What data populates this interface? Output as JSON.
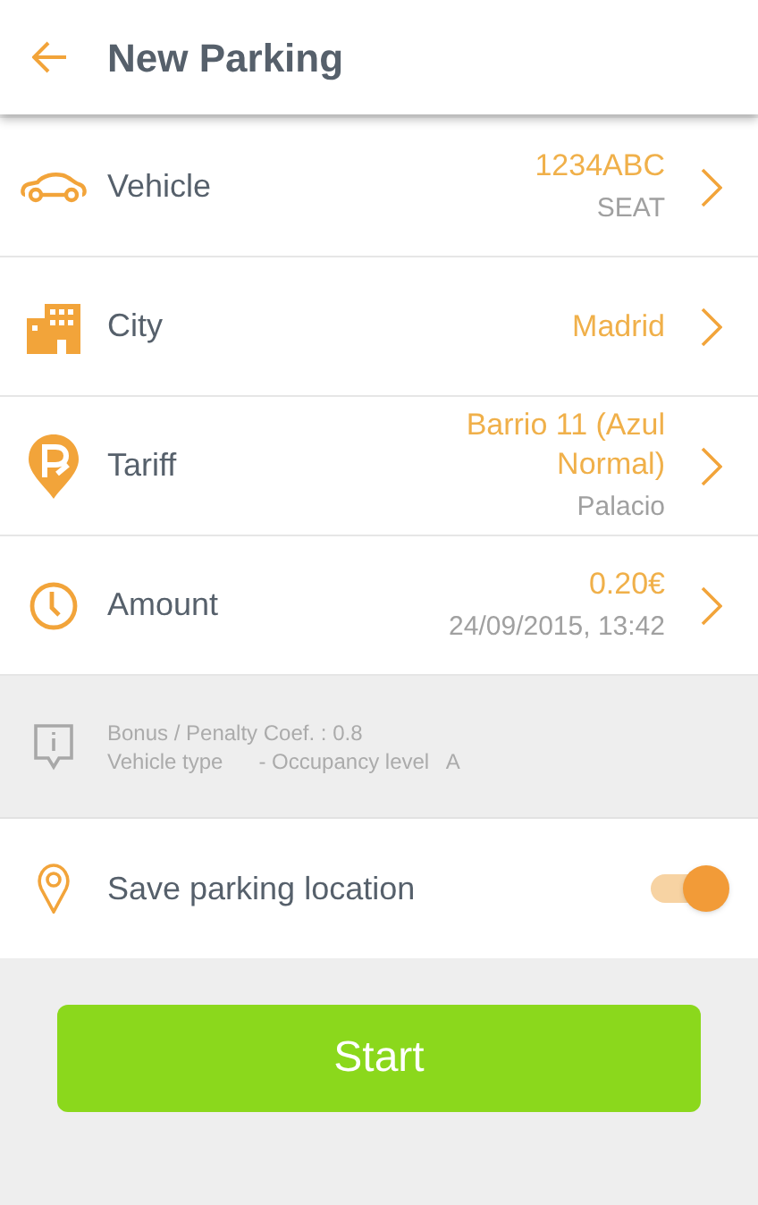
{
  "header": {
    "title": "New Parking"
  },
  "rows": [
    {
      "kind": "car",
      "label": "Vehicle",
      "value": "1234ABC",
      "detail": "SEAT"
    },
    {
      "kind": "building",
      "label": "City",
      "value": "Madrid"
    },
    {
      "kind": "tariff",
      "label": "Tariff",
      "value": "Barrio 11 (Azul Normal)",
      "detail": "Palacio"
    },
    {
      "kind": "clock",
      "label": "Amount",
      "value": "0.20€",
      "detail": "24/09/2015, 13:42"
    }
  ],
  "info": {
    "lines": [
      "Bonus / Penalty Coef. : 0.8",
      "Vehicle type      - Occupancy level   A"
    ]
  },
  "save_location": {
    "label": "Save parking location",
    "on": true
  },
  "start_button": {
    "label": "Start"
  }
}
